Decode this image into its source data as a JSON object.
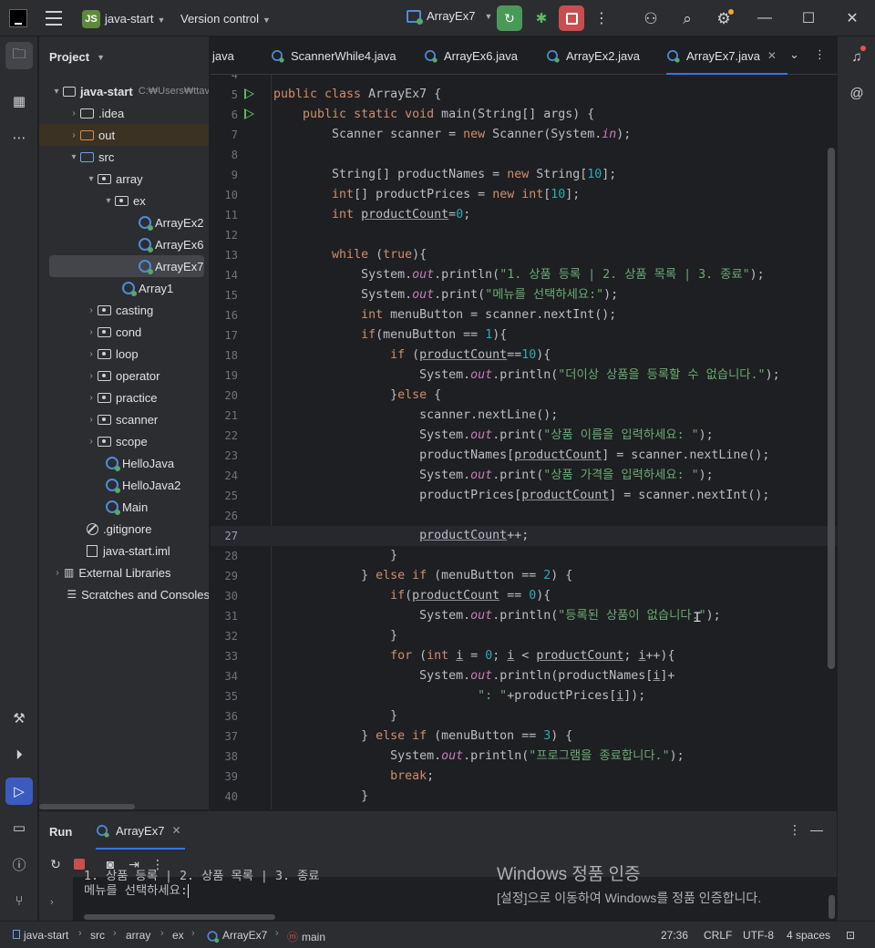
{
  "titlebar": {
    "project_initials": "JS",
    "project_name": "java-start",
    "vcs_label": "Version control",
    "run_config": "ArrayEx7"
  },
  "project_panel": {
    "title": "Project",
    "root_name": "java-start",
    "root_path": "C:₩Users₩ttav",
    "items": {
      "idea": ".idea",
      "out": "out",
      "src": "src",
      "array": "array",
      "ex": "ex",
      "arrayex2": "ArrayEx2",
      "arrayex6": "ArrayEx6",
      "arrayex7": "ArrayEx7",
      "array1": "Array1",
      "casting": "casting",
      "cond": "cond",
      "loop": "loop",
      "operator": "operator",
      "practice": "practice",
      "scanner": "scanner",
      "scope": "scope",
      "hellojava": "HelloJava",
      "hellojava2": "HelloJava2",
      "main": "Main",
      "gitignore": ".gitignore",
      "iml": "java-start.iml",
      "ext_libs": "External Libraries",
      "scratches": "Scratches and Consoles"
    }
  },
  "editor": {
    "tabs": [
      "java",
      "ScannerWhile4.java",
      "ArrayEx6.java",
      "ArrayEx2.java",
      "ArrayEx7.java"
    ],
    "active_tab": "ArrayEx7.java",
    "line_numbers": [
      "4",
      "5",
      "6",
      "7",
      "8",
      "9",
      "10",
      "11",
      "12",
      "13",
      "14",
      "15",
      "16",
      "17",
      "18",
      "19",
      "20",
      "21",
      "22",
      "23",
      "24",
      "25",
      "26",
      "27",
      "28",
      "29",
      "30",
      "31",
      "32",
      "33",
      "34",
      "35",
      "36",
      "37",
      "38",
      "39",
      "40"
    ],
    "current_line": "27"
  },
  "run_panel": {
    "title": "Run",
    "tab": "ArrayEx7",
    "console_line1": "1. 상품 등록 | 2. 상품 목록 | 3. 종료",
    "console_line2": "메뉴를 선택하세요:"
  },
  "watermark": {
    "title": "Windows 정품 인증",
    "subtitle": "[설정]으로 이동하여 Windows를 정품 인증합니다."
  },
  "statusbar": {
    "crumbs": [
      "java-start",
      "src",
      "array",
      "ex",
      "ArrayEx7",
      "main"
    ],
    "position": "27:36",
    "line_sep": "CRLF",
    "encoding": "UTF-8",
    "indent": "4 spaces"
  },
  "colors": {
    "accent": "#3574f0",
    "run_green": "#4a9a57",
    "stop_red": "#c94f4f",
    "keyword": "#cf8e6d",
    "string": "#6aab73",
    "number": "#2aacb8",
    "field": "#c77dbb"
  }
}
